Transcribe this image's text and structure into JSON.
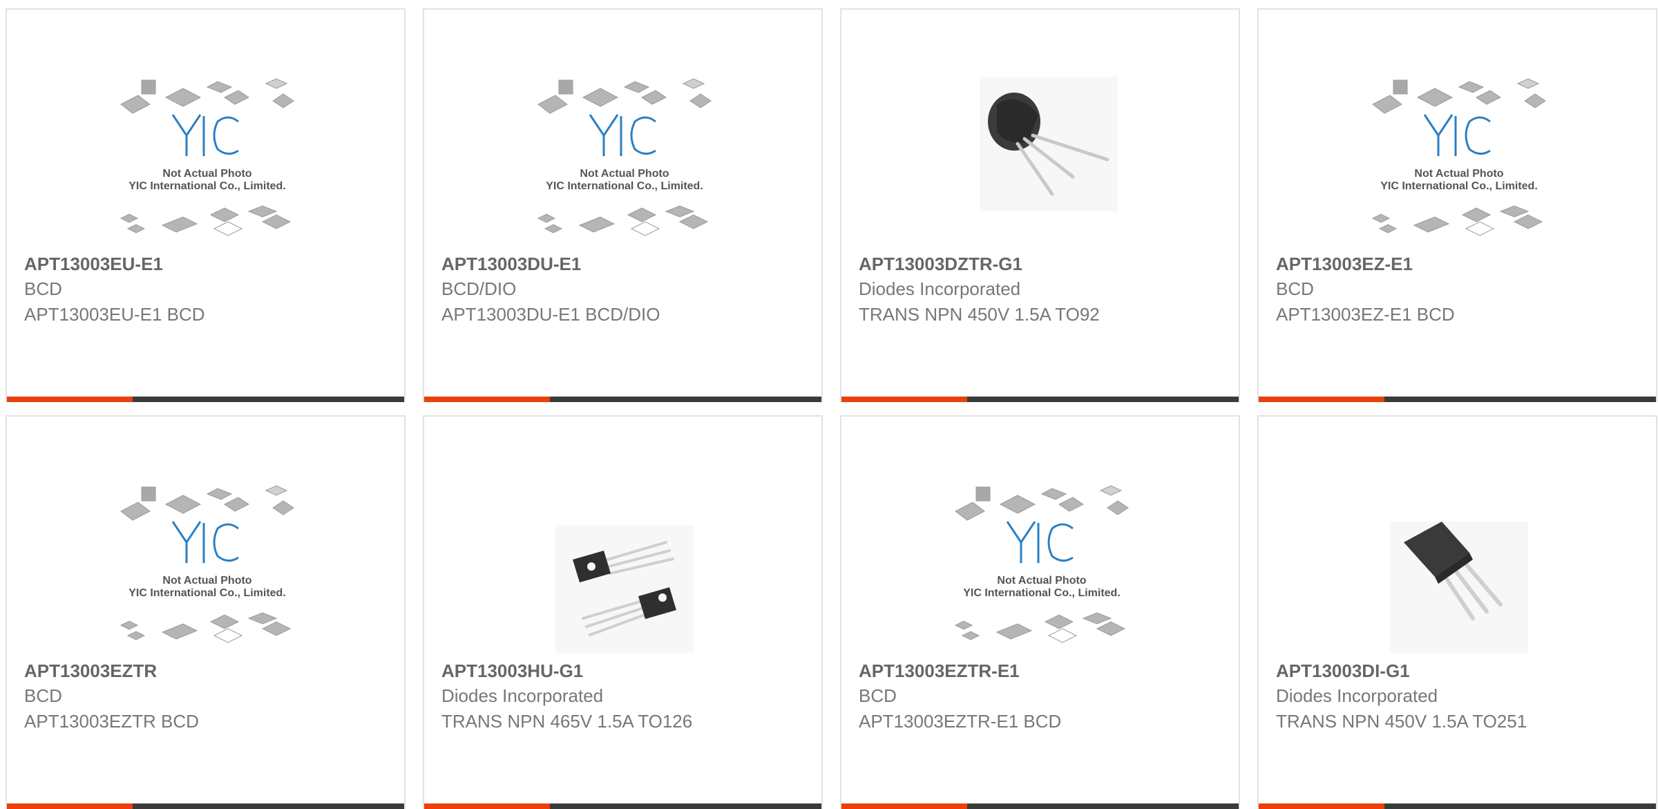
{
  "products": [
    {
      "part": "APT13003EU-E1",
      "maker": "BCD",
      "desc": "APT13003EU-E1 BCD",
      "image": "yic-placeholder",
      "placeholder_line1": "Not Actual Photo",
      "placeholder_line2": "YIC International Co., Limited."
    },
    {
      "part": "APT13003DU-E1",
      "maker": "BCD/DIO",
      "desc": "APT13003DU-E1 BCD/DIO",
      "image": "yic-placeholder",
      "placeholder_line1": "Not Actual Photo",
      "placeholder_line2": "YIC International Co., Limited."
    },
    {
      "part": "APT13003DZTR-G1",
      "maker": "Diodes Incorporated",
      "desc": "TRANS NPN 450V 1.5A TO92",
      "image": "to92-transistor-photo"
    },
    {
      "part": "APT13003EZ-E1",
      "maker": "BCD",
      "desc": "APT13003EZ-E1 BCD",
      "image": "yic-placeholder",
      "placeholder_line1": "Not Actual Photo",
      "placeholder_line2": "YIC International Co., Limited."
    },
    {
      "part": "APT13003EZTR",
      "maker": "BCD",
      "desc": "APT13003EZTR BCD",
      "image": "yic-placeholder",
      "placeholder_line1": "Not Actual Photo",
      "placeholder_line2": "YIC International Co., Limited."
    },
    {
      "part": "APT13003HU-G1",
      "maker": "Diodes Incorporated",
      "desc": "TRANS NPN 465V 1.5A TO126",
      "image": "to126-transistor-photo"
    },
    {
      "part": "APT13003EZTR-E1",
      "maker": "BCD",
      "desc": "APT13003EZTR-E1 BCD",
      "image": "yic-placeholder",
      "placeholder_line1": "Not Actual Photo",
      "placeholder_line2": "YIC International Co., Limited."
    },
    {
      "part": "APT13003DI-G1",
      "maker": "Diodes Incorporated",
      "desc": "TRANS NPN 450V 1.5A TO251",
      "image": "to251-transistor-photo"
    }
  ],
  "colors": {
    "accent": "#e8410a",
    "bar": "#3a3a3a",
    "logo_blue": "#2a7fc4"
  }
}
